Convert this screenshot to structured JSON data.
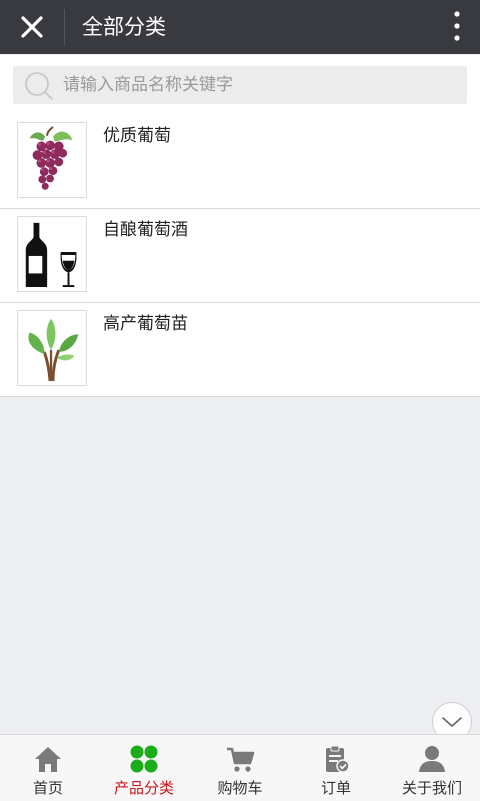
{
  "header": {
    "title": "全部分类"
  },
  "search": {
    "placeholder": "请输入商品名称关键字"
  },
  "categories": [
    {
      "name": "优质葡萄",
      "icon": "grapes-icon"
    },
    {
      "name": "自酿葡萄酒",
      "icon": "wine-bottle-glass-icon"
    },
    {
      "name": "高产葡萄苗",
      "icon": "seedling-icon"
    }
  ],
  "tabbar": {
    "active_color": "#c8161d",
    "items": [
      {
        "label": "首页",
        "icon": "home-icon"
      },
      {
        "label": "产品分类",
        "icon": "grid-dots-icon",
        "active": true
      },
      {
        "label": "购物车",
        "icon": "cart-icon"
      },
      {
        "label": "订单",
        "icon": "clipboard-check-icon"
      },
      {
        "label": "关于我们",
        "icon": "person-icon"
      }
    ]
  },
  "colors": {
    "header_bg": "#393a3f",
    "page_bg": "#eceef1",
    "accent": "#c8161d",
    "tab_active_icon": "#1aad19"
  }
}
